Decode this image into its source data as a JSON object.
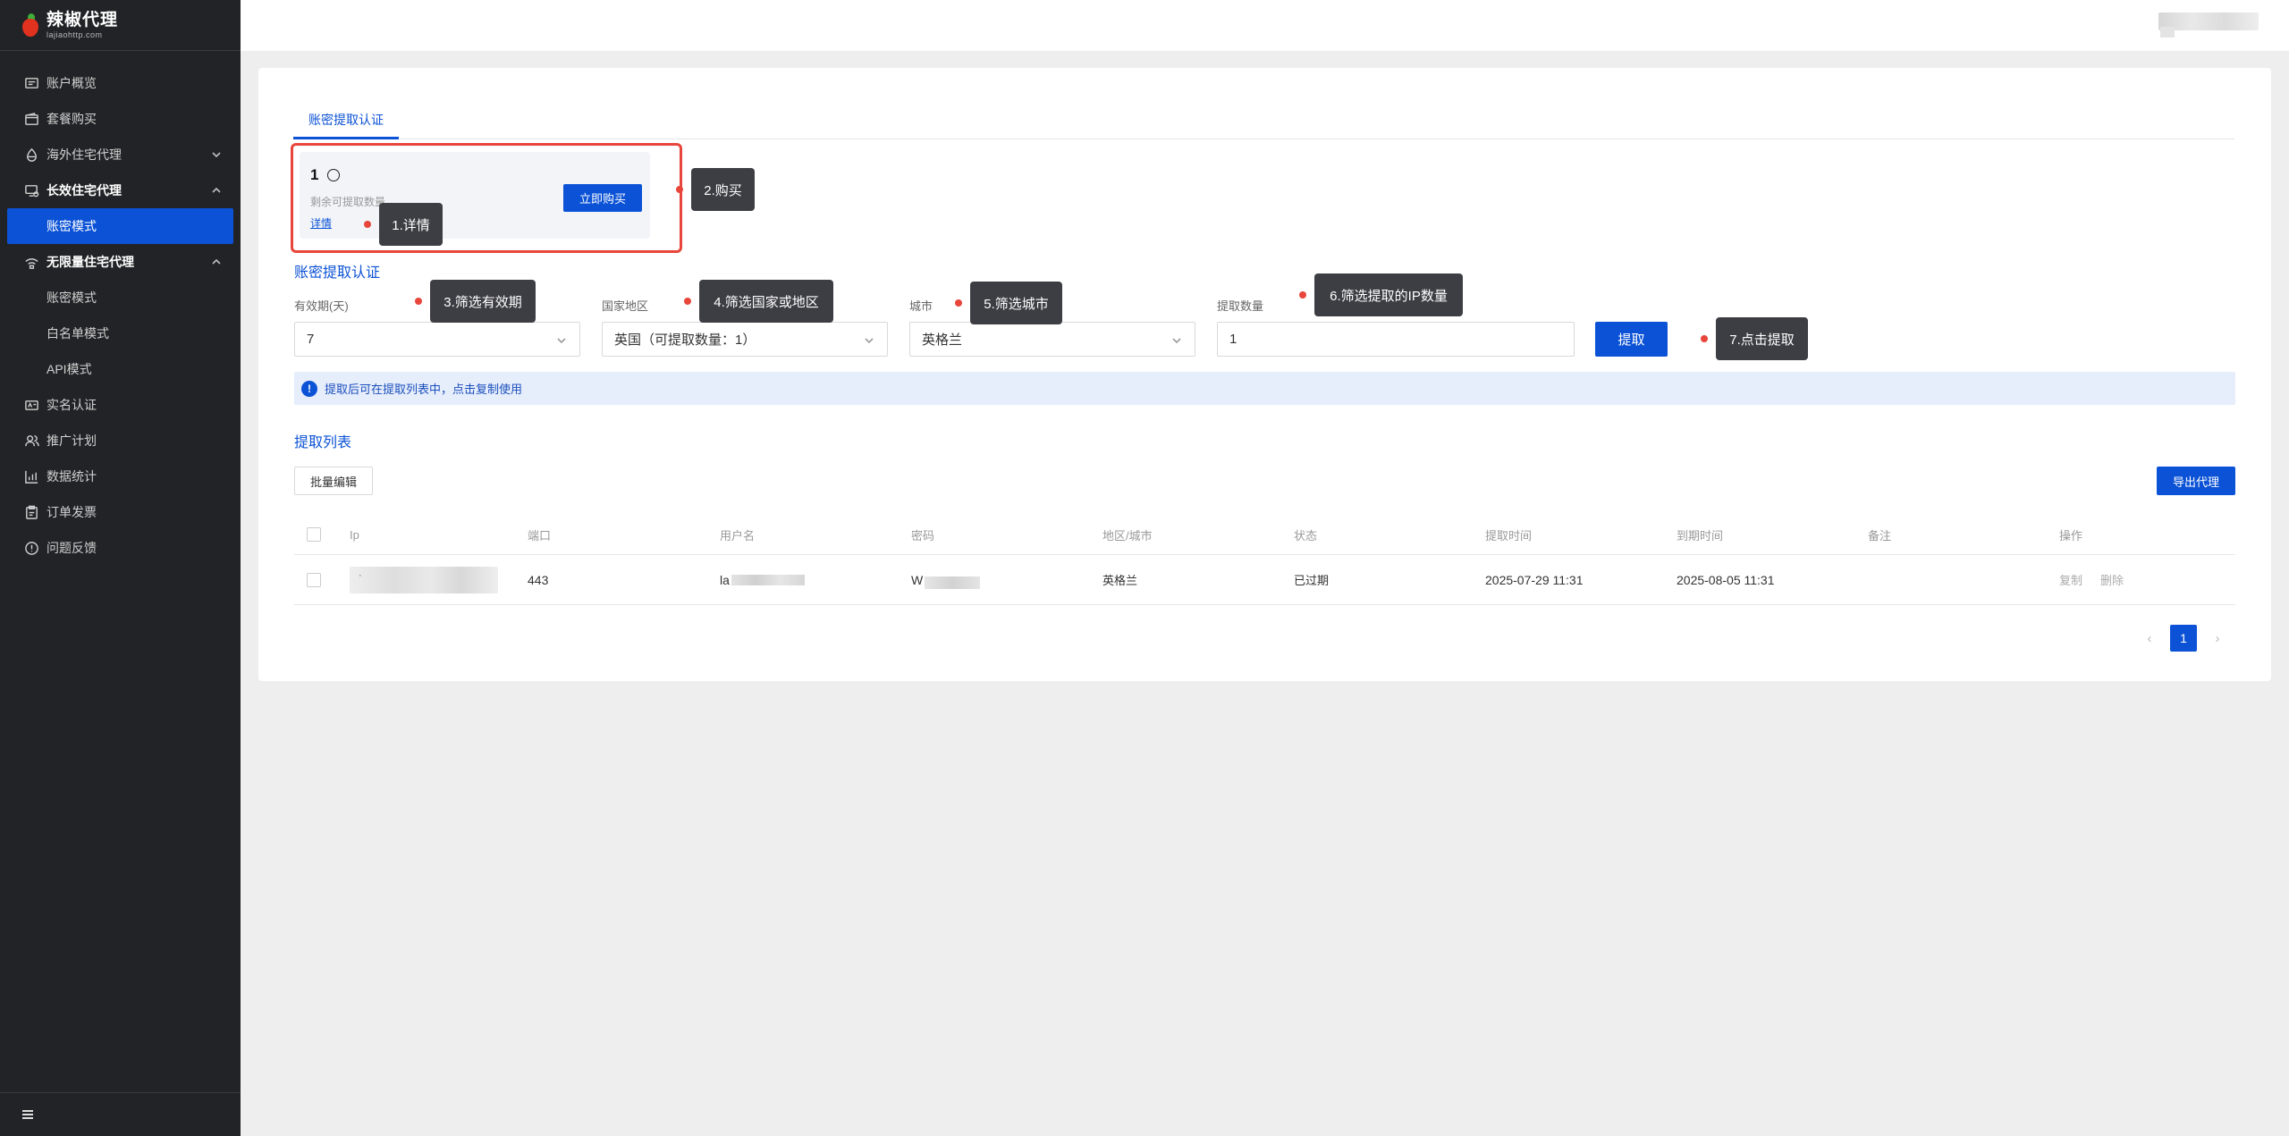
{
  "brand": {
    "name": "辣椒代理",
    "domain": "lajiaohttp.com"
  },
  "sidebar": {
    "items": [
      {
        "label": "账户概览",
        "icon": "dashboard-icon"
      },
      {
        "label": "套餐购买",
        "icon": "wallet-icon"
      },
      {
        "label": "海外住宅代理",
        "icon": "globe-icon"
      },
      {
        "label": "长效住宅代理",
        "icon": "monitor-icon"
      },
      {
        "label": "账密模式"
      },
      {
        "label": "无限量住宅代理",
        "icon": "signal-icon"
      },
      {
        "label": "账密模式"
      },
      {
        "label": "白名单模式"
      },
      {
        "label": "API模式"
      },
      {
        "label": "实名认证",
        "icon": "id-card-icon"
      },
      {
        "label": "推广计划",
        "icon": "users-icon"
      },
      {
        "label": "数据统计",
        "icon": "bar-chart-icon"
      },
      {
        "label": "订单发票",
        "icon": "clipboard-icon"
      },
      {
        "label": "问题反馈",
        "icon": "alert-icon"
      }
    ]
  },
  "tabs": {
    "active": "账密提取认证"
  },
  "quota": {
    "count": "1",
    "desc": "剩余可提取数量",
    "detail_link": "详情",
    "buy_label": "立即购买"
  },
  "form": {
    "section_title": "账密提取认证",
    "validity_label": "有效期(天)",
    "validity_value": "7",
    "country_label": "国家地区",
    "country_value": "英国（可提取数量：1）",
    "city_label": "城市",
    "city_value": "英格兰",
    "quantity_label": "提取数量",
    "quantity_value": "1",
    "extract_label": "提取"
  },
  "info": {
    "text": "提取后可在提取列表中，点击复制使用"
  },
  "list": {
    "section_title": "提取列表",
    "batch_label": "批量编辑",
    "export_label": "导出代理",
    "headers": [
      "Ip",
      "端口",
      "用户名",
      "密码",
      "地区/城市",
      "状态",
      "提取时间",
      "到期时间",
      "备注",
      "操作"
    ],
    "rows": [
      {
        "ip_prefix": "·",
        "port": "443",
        "username_prefix": "la",
        "password_prefix": "W",
        "region": "英格兰",
        "status": "已过期",
        "extract_time": "2025-07-29 11:31",
        "expire_time": "2025-08-05 11:31",
        "note": "",
        "copy": "复制",
        "delete": "删除"
      }
    ]
  },
  "pagination": {
    "prev": "‹",
    "current": "1",
    "next": "›"
  },
  "annotations": {
    "a1": "1.详情",
    "a2": "2.购买",
    "a3": "3.筛选有效期",
    "a4": "4.筛选国家或地区",
    "a5": "5.筛选城市",
    "a6": "6.筛选提取的IP数量",
    "a7": "7.点击提取"
  },
  "colors": {
    "primary": "#0b52d6",
    "sidebar_bg": "#222326",
    "annotation_bg": "#3d3e44",
    "highlight_red": "#e8463a"
  }
}
